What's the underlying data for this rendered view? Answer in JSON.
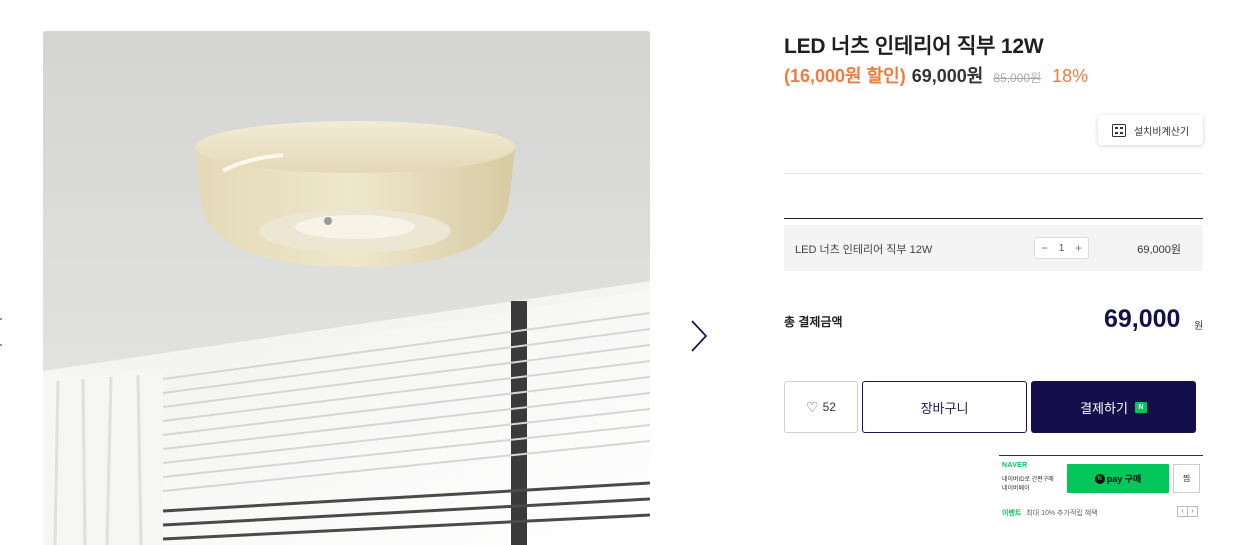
{
  "product": {
    "title": "LED 너츠 인테리어 직부 12W",
    "discount_text": "(16,000원 할인)",
    "sale_price": "69,000원",
    "original_price": "85,000원",
    "discount_rate": "18%"
  },
  "calculator_button": {
    "label": "설치비계산기",
    "icon": "calculator-icon"
  },
  "option": {
    "name": "LED 너츠 인테리어 직부 12W",
    "quantity": "1",
    "minus": "−",
    "plus": "+",
    "price": "69,000원"
  },
  "total": {
    "label": "총 결제금액",
    "amount": "69,000",
    "unit": "원"
  },
  "actions": {
    "wish_icon": "heart-icon",
    "wish_count": "52",
    "cart_label": "장바구니",
    "buy_label": "결제하기",
    "buy_badge": "N"
  },
  "naver_pay": {
    "logo": "NAVER",
    "desc_line1": "네이버ID로 간편구매",
    "desc_line2": "네이버페이",
    "pay_button_badge": "N",
    "pay_button_label": "pay 구매",
    "wish_label": "찜",
    "event_label": "이벤트",
    "event_text": "최대 10% 추가적립 혜택",
    "prev_arrow": "‹",
    "next_arrow": "›"
  },
  "colors": {
    "accent_orange": "#f07b3f",
    "brand_navy": "#140e4b",
    "naver_green": "#03c75a"
  }
}
